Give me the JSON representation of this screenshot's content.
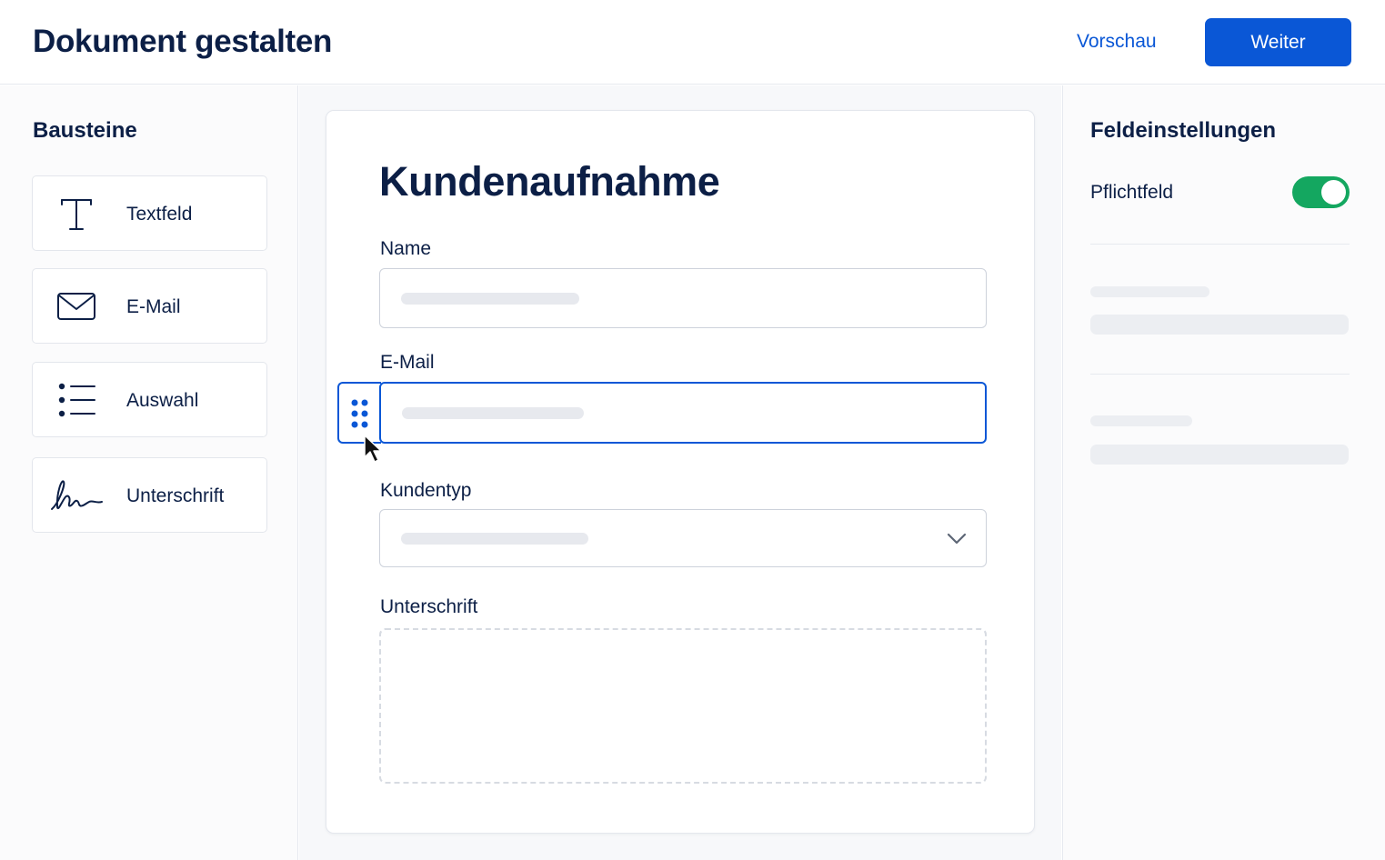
{
  "header": {
    "title": "Dokument gestalten",
    "preview_label": "Vorschau",
    "next_label": "Weiter"
  },
  "sidebar": {
    "heading": "Bausteine",
    "items": [
      {
        "label": "Textfeld",
        "icon": "text-t-icon"
      },
      {
        "label": "E-Mail",
        "icon": "envelope-icon"
      },
      {
        "label": "Auswahl",
        "icon": "list-icon"
      },
      {
        "label": "Unterschrift",
        "icon": "signature-icon"
      }
    ]
  },
  "document": {
    "title": "Kundenaufnahme",
    "fields": [
      {
        "label": "Name",
        "type": "text"
      },
      {
        "label": "E-Mail",
        "type": "email",
        "selected": true
      },
      {
        "label": "Kundentyp",
        "type": "select"
      },
      {
        "label": "Unterschrift",
        "type": "signature"
      }
    ]
  },
  "settings": {
    "heading": "Feldeinstellungen",
    "required_label": "Pflichtfeld",
    "required_on": true
  },
  "colors": {
    "accent": "#0a57d6",
    "toggle_on": "#14a760",
    "text": "#0c1f46"
  }
}
